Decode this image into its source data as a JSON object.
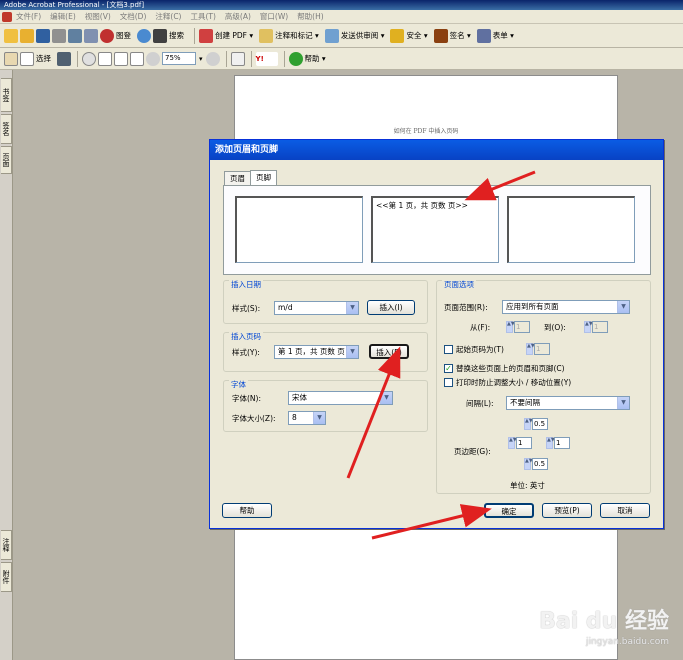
{
  "window": {
    "title": "Adobe Acrobat Professional - [文档3.pdf]"
  },
  "menu": [
    "文件(F)",
    "编辑(E)",
    "视图(V)",
    "文档(D)",
    "注释(C)",
    "工具(T)",
    "高级(A)",
    "窗口(W)",
    "帮助(H)"
  ],
  "toolbar1": {
    "org": "图登",
    "search": "搜索",
    "create_pdf": "创建 PDF",
    "comment": "注释和标记",
    "send_review": "发送供审阅",
    "security": "安全",
    "sign": "签名",
    "forms": "表单"
  },
  "toolbar2": {
    "select": "选择",
    "zoom": "75%",
    "help": "帮助"
  },
  "left_tabs": [
    "书签",
    "签名",
    "页面"
  ],
  "left_tabs_bottom": [
    "注释",
    "附件"
  ],
  "page": {
    "header_text": "如何在 PDF 中插入页码"
  },
  "dialog": {
    "title": "添加页眉和页脚",
    "tabs": [
      "页眉",
      "页脚"
    ],
    "boxes": {
      "left": "",
      "center": "<<第 1 页，共 页数 页>>",
      "right": ""
    },
    "insert_date": {
      "legend": "插入日期",
      "style_label": "样式(S):",
      "style_value": "m/d",
      "insert_button": "插入(I)"
    },
    "insert_page": {
      "legend": "插入页码",
      "style_label": "样式(Y):",
      "style_value": "第 1 页，共 页数 页",
      "insert_button": "插入(E)"
    },
    "font": {
      "legend": "字体",
      "name_label": "字体(N):",
      "name_value": "宋体",
      "size_label": "字体大小(Z):",
      "size_value": "8"
    },
    "page_options": {
      "legend": "页面选项",
      "range_label": "页面范围(R):",
      "range_value": "应用到所有页面",
      "from_label": "从(F):",
      "from_value": "1",
      "to_label": "到(O):",
      "to_value": "1",
      "start_label": "起始页码为(T)",
      "start_value": "1",
      "replace_label": "替换这些页面上的页眉和页脚(C)",
      "prevent_label": "打印时防止调整大小 / 移动位置(Y)",
      "spacing_label": "间隔(L):",
      "spacing_value": "不要间隔",
      "margin_label": "页边距(G):",
      "margin_top": "0.5",
      "margin_left": "1",
      "margin_right": "1",
      "margin_bottom": "0.5",
      "unit_label": "单位: 英寸"
    },
    "buttons": {
      "help": "帮助",
      "ok": "确定",
      "preview": "预览(P)",
      "cancel": "取消"
    }
  },
  "watermark": {
    "brand": "Bai du 经验",
    "url": "jingyan.baidu.com"
  },
  "colors": {
    "arrow": "#e02020",
    "title_bar": "#0842c4"
  }
}
